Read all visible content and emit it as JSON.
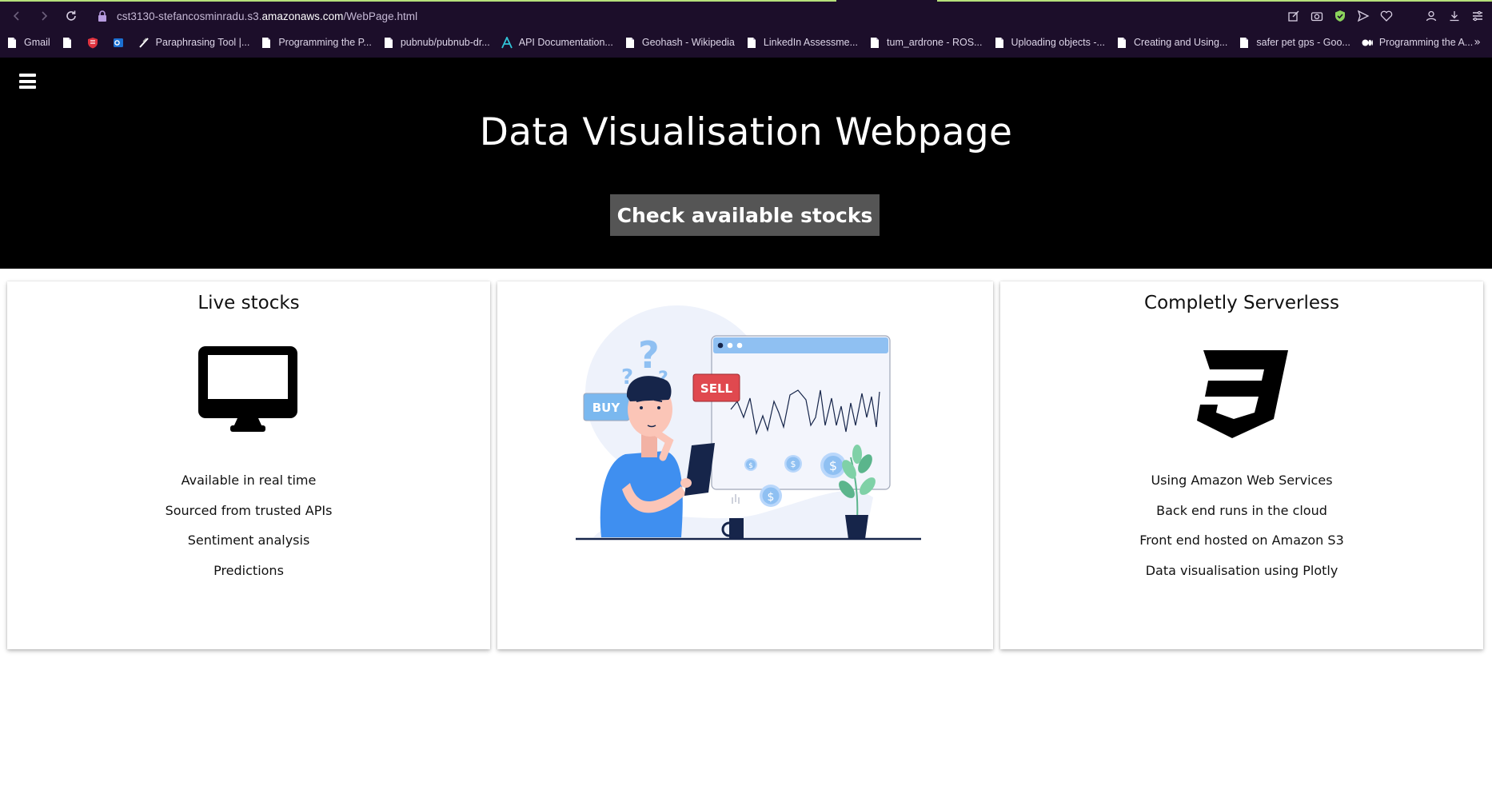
{
  "browser": {
    "url_prefix": "cst3130-stefancosminradu.s3.",
    "url_host": "amazonaws.com",
    "url_path": "/WebPage.html",
    "bookmarks": [
      {
        "label": "Gmail",
        "icon": "doc-icon"
      },
      {
        "label": "",
        "icon": "doc-icon"
      },
      {
        "label": "",
        "icon": "shield-icon"
      },
      {
        "label": "",
        "icon": "outlook-icon"
      },
      {
        "label": "Paraphrasing Tool |...",
        "icon": "quill-icon"
      },
      {
        "label": "Programming the P...",
        "icon": "doc-icon"
      },
      {
        "label": "pubnub/pubnub-dr...",
        "icon": "doc-icon"
      },
      {
        "label": "API Documentation...",
        "icon": "a-logo-icon"
      },
      {
        "label": "Geohash - Wikipedia",
        "icon": "doc-icon"
      },
      {
        "label": "LinkedIn Assessme...",
        "icon": "doc-icon"
      },
      {
        "label": "tum_ardrone - ROS...",
        "icon": "doc-icon"
      },
      {
        "label": "Uploading objects -...",
        "icon": "doc-icon"
      },
      {
        "label": "Creating and Using...",
        "icon": "doc-icon"
      },
      {
        "label": "safer pet gps - Goo...",
        "icon": "doc-icon"
      },
      {
        "label": "Programming the A...",
        "icon": "medium-icon"
      }
    ],
    "more_label": "»"
  },
  "header": {
    "menu_icon": "hamburger-menu-icon",
    "title": "Data Visualisation Webpage",
    "cta_label": "Check available stocks"
  },
  "cards": {
    "left": {
      "title": "Live stocks",
      "icon": "desktop-monitor-icon",
      "items": [
        "Available in real time",
        "Sourced from trusted APIs",
        "Sentiment analysis",
        "Predictions"
      ]
    },
    "middle": {
      "illustration": "stock-trader-illustration",
      "buy_label": "BUY",
      "sell_label": "SELL",
      "question_marks": "?",
      "coin_symbol": "$"
    },
    "right": {
      "title": "Completly Serverless",
      "icon": "css3-logo-icon",
      "items": [
        "Using Amazon Web Services",
        "Back end runs in the cloud",
        "Front end hosted on Amazon S3",
        "Data visualisation using Plotly"
      ]
    }
  },
  "colors": {
    "chrome_bg": "#1c0e2a",
    "header_bg": "#000000",
    "cta_bg": "#555555",
    "buy_blue": "#7ab8ef",
    "sell_red": "#e0494f",
    "person_blue": "#3f8ff0",
    "navy": "#16254a"
  }
}
